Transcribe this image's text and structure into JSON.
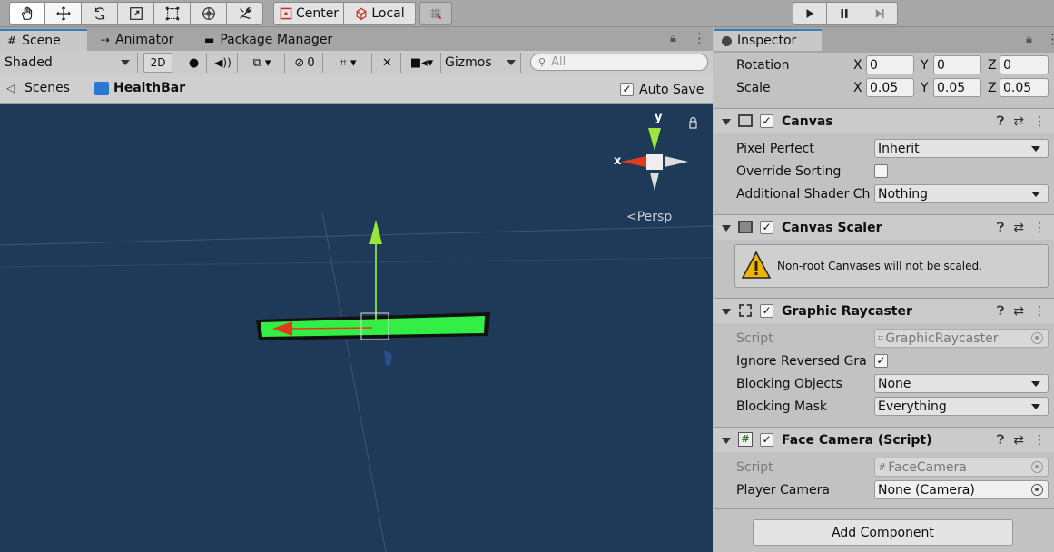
{
  "toolbar": {
    "pivot_label": "Center",
    "space_label": "Local"
  },
  "scene_tabs": [
    {
      "label": "Scene"
    },
    {
      "label": "Animator"
    },
    {
      "label": "Package Manager"
    }
  ],
  "scene_toolbar": {
    "shading_mode": "Shaded",
    "mode_2d": "2D",
    "hidden_count": "0",
    "gizmos_label": "Gizmos",
    "search_placeholder": "All"
  },
  "breadcrumb": {
    "root": "Scenes",
    "prefab": "HealthBar",
    "auto_save_label": "Auto Save",
    "auto_save_checked": true
  },
  "viewport": {
    "axis_x": "x",
    "axis_y": "y",
    "projection_label": "Persp"
  },
  "inspector": {
    "tab_label": "Inspector",
    "transform": {
      "rotation_label": "Rotation",
      "rotation": {
        "x": "0",
        "y": "0",
        "z": "0"
      },
      "scale_label": "Scale",
      "scale": {
        "x": "0.05",
        "y": "0.05",
        "z": "0.05"
      },
      "x_label": "X",
      "y_label": "Y",
      "z_label": "Z"
    },
    "canvas": {
      "title": "Canvas",
      "pixel_perfect_label": "Pixel Perfect",
      "pixel_perfect_value": "Inherit",
      "override_sorting_label": "Override Sorting",
      "additional_shader_label": "Additional Shader Ch",
      "additional_shader_value": "Nothing"
    },
    "canvas_scaler": {
      "title": "Canvas Scaler",
      "warning": "Non-root Canvases will not be scaled."
    },
    "graphic_raycaster": {
      "title": "Graphic Raycaster",
      "script_label": "Script",
      "script_value": "GraphicRaycaster",
      "ignore_reversed_label": "Ignore Reversed Gra",
      "blocking_objects_label": "Blocking Objects",
      "blocking_objects_value": "None",
      "blocking_mask_label": "Blocking Mask",
      "blocking_mask_value": "Everything"
    },
    "face_camera": {
      "title": "Face Camera (Script)",
      "script_label": "Script",
      "script_value": "FaceCamera",
      "player_camera_label": "Player Camera",
      "player_camera_value": "None (Camera)"
    },
    "add_component_label": "Add Component"
  },
  "colors": {
    "scene_bg": "#1f3a58",
    "health_bar": "#33ee44",
    "x_axis": "#e33a1c",
    "y_axis": "#9be53c",
    "accent_tab": "#3a79bb"
  }
}
